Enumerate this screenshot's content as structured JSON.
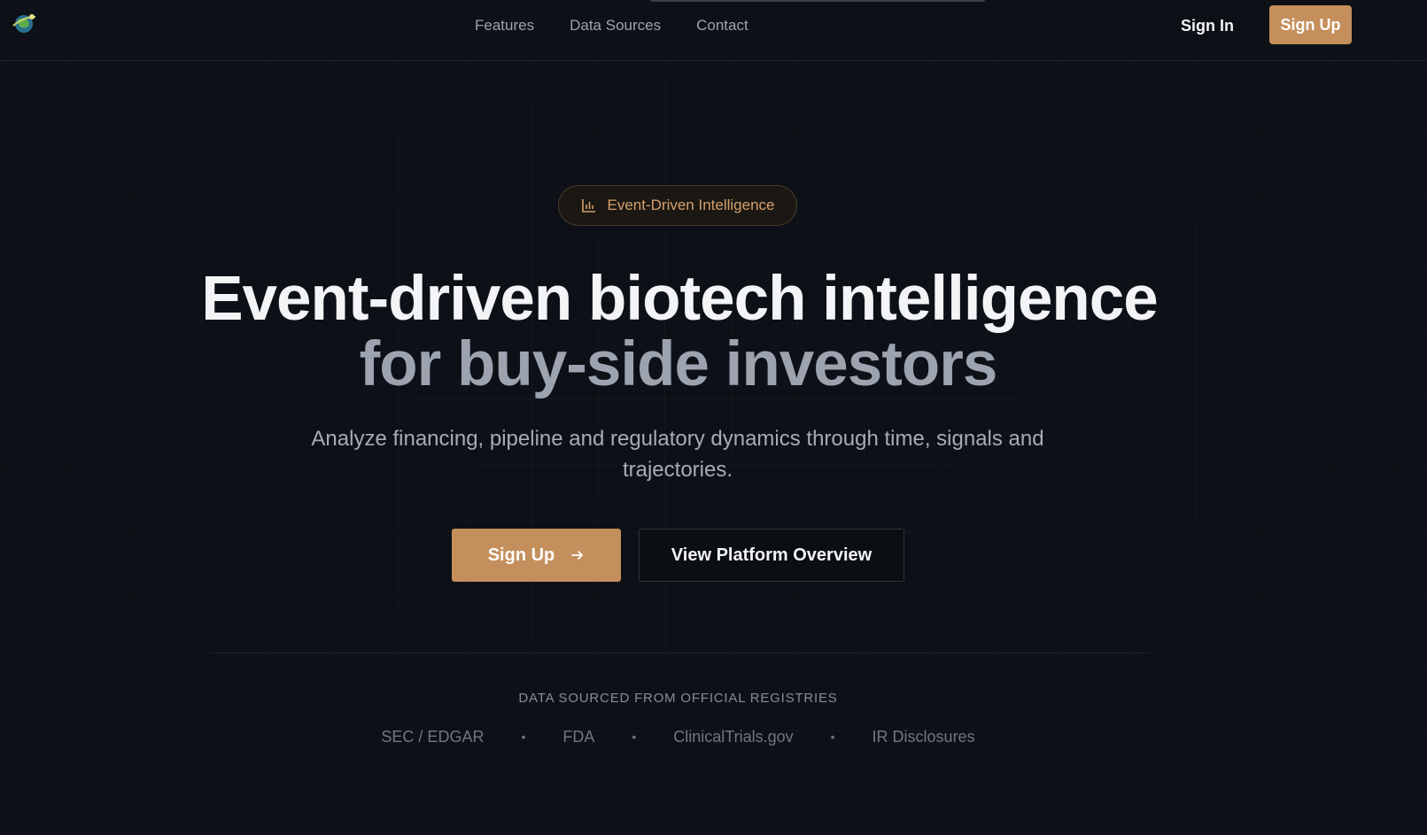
{
  "header": {
    "nav": [
      "Features",
      "Data Sources",
      "Contact"
    ],
    "sign_in": "Sign In",
    "sign_up": "Sign Up"
  },
  "hero": {
    "badge": "Event-Driven Intelligence",
    "badge_icon": "bar-chart-icon",
    "headline_line1": "Event-driven biotech intelligence",
    "headline_line2": "for buy-side investors",
    "subtitle": "Analyze financing, pipeline and regulatory dynamics through time, signals and trajectories.",
    "cta_primary": "Sign Up",
    "cta_primary_icon": "arrow-right-icon",
    "cta_secondary": "View Platform Overview"
  },
  "sources": {
    "label": "DATA SOURCED FROM OFFICIAL REGISTRIES",
    "items": [
      "SEC / EDGAR",
      "FDA",
      "ClinicalTrials.gov",
      "IR Disclosures"
    ]
  },
  "colors": {
    "background": "#0d1117",
    "accent": "#c48f5c",
    "badge_text": "#d6a06c"
  }
}
